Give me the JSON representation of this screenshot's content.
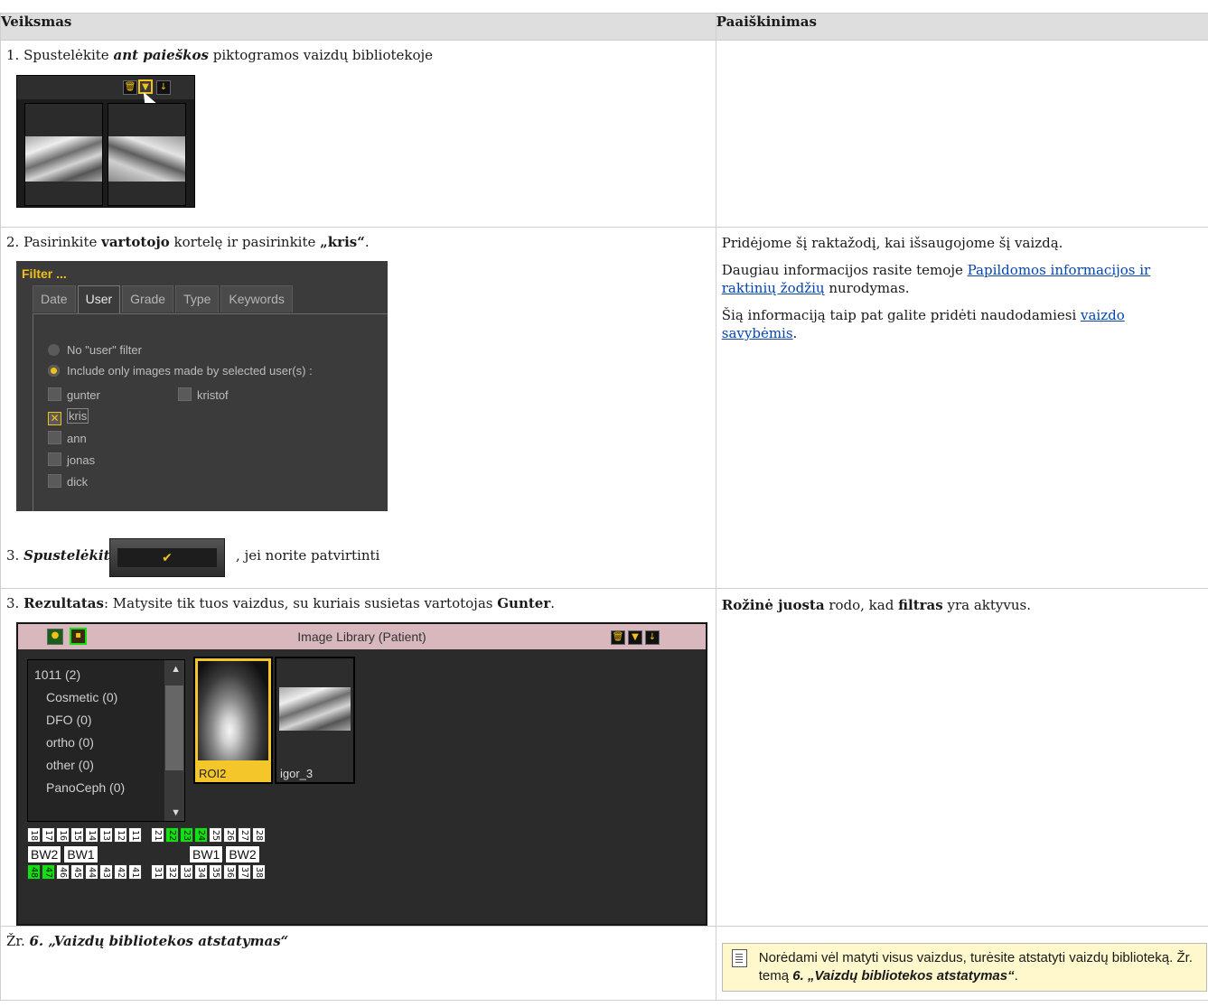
{
  "table": {
    "header": {
      "col1": "Veiksmas",
      "col2": "Paaiškinimas"
    },
    "row1": {
      "step": {
        "num": "1. Spustelėkite ",
        "em": "ant paieškos",
        "rest": " piktogramos vaizdų bibliotekoje"
      }
    },
    "row2": {
      "step2": {
        "num": "2. Pasirinkite ",
        "bold1": "vartotojo",
        "mid": " kortelę ir pasirinkite ",
        "bold2": "„kris“",
        "end": "."
      },
      "filter": {
        "title": "Filter ...",
        "tabs": [
          "Date",
          "User",
          "Grade",
          "Type",
          "Keywords"
        ],
        "active_tab": "User",
        "radio_none": "No \"user\" filter",
        "radio_include": "Include only images made by selected user(s) :",
        "users": [
          "gunter",
          "kris",
          "ann",
          "jonas",
          "dick"
        ],
        "user_right": "kristof",
        "checked": "kris"
      },
      "step3": {
        "num": "3. ",
        "em": "Spustelėkite",
        "rest": ", jei norite patvirtinti"
      },
      "ok_glyph": "✔",
      "explain": {
        "p1": "Pridėjome šį raktažodį, kai išsaugojome šį vaizdą.",
        "p2_pre": "Daugiau informacijos rasite temoje ",
        "p2_link": "Papildomos informacijos ir raktinių žodžių",
        "p2_post": " nurodymas.",
        "p3_pre": "Šią informaciją taip pat galite pridėti naudodamiesi ",
        "p3_link": "vaizdo savybėmis",
        "p3_post": "."
      }
    },
    "row3": {
      "result": {
        "num": "3. ",
        "bold1": "Rezultatas",
        "mid": ": Matysite tik tuos vaizdus, su kuriais susietas vartotojas ",
        "bold2": "Gunter",
        "end": "."
      },
      "library": {
        "title": "Image Library (Patient)",
        "tree": [
          "1011 (2)",
          "Cosmetic (0)",
          "DFO (0)",
          "ortho (0)",
          "other (0)",
          "PanoCeph (0)"
        ],
        "images": [
          "ROI2",
          "igor_3"
        ],
        "upper_left": [
          "18",
          "17",
          "16",
          "15",
          "14",
          "13",
          "12",
          "11"
        ],
        "upper_right": [
          "21",
          "22",
          "23",
          "24",
          "25",
          "26",
          "27",
          "28"
        ],
        "lower_left": [
          "48",
          "47",
          "46",
          "45",
          "44",
          "43",
          "42",
          "41"
        ],
        "lower_right": [
          "31",
          "32",
          "33",
          "34",
          "35",
          "36",
          "37",
          "38"
        ],
        "bw_left": [
          "BW2",
          "BW1"
        ],
        "bw_right": [
          "BW1",
          "BW2"
        ],
        "green_upper": [
          "22",
          "23",
          "24"
        ],
        "green_lower": [
          "48",
          "47"
        ]
      },
      "explain": {
        "bold1": "Rožinė juosta",
        "mid": " rodo, kad ",
        "bold2": "filtras",
        "end": " yra aktyvus."
      }
    },
    "row4": {
      "ref": {
        "pre": "Žr. ",
        "em": "6. „Vaizdų bibliotekos atstatymas“"
      },
      "note": {
        "pre": "Norėdami vėl matyti visus vaizdus, turėsite atstatyti vaizdų biblioteką. Žr. temą ",
        "em": "6. „Vaizdų bibliotekos atstatymas“",
        "end": "."
      }
    }
  },
  "colors": {
    "pink_bar": "#d8b8bd",
    "accent_yellow": "#f2c019",
    "tooth_green": "#11e011"
  }
}
